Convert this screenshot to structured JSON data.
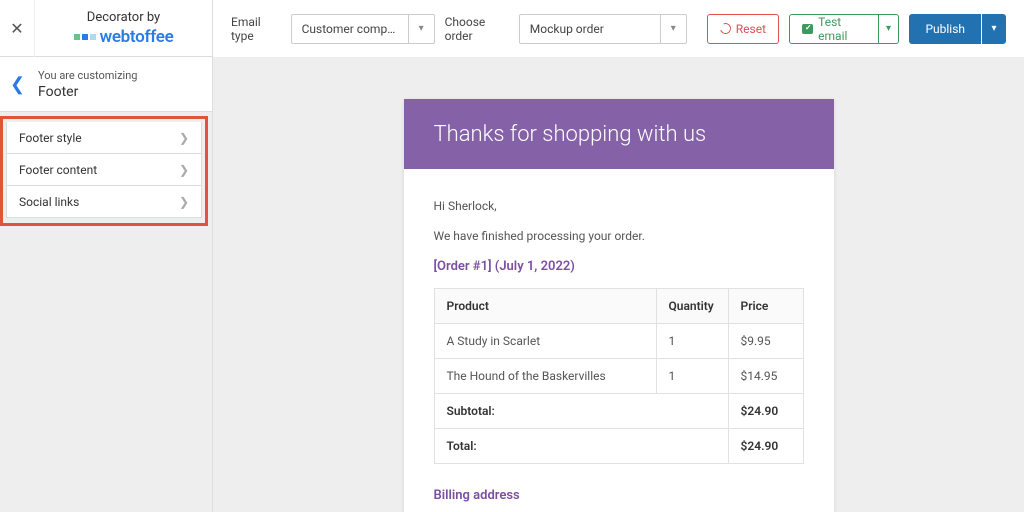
{
  "brand": {
    "top": "Decorator by",
    "name": "webtoffee"
  },
  "crumb": {
    "label": "You are customizing",
    "title": "Footer"
  },
  "options": [
    {
      "label": "Footer style"
    },
    {
      "label": "Footer content"
    },
    {
      "label": "Social links"
    }
  ],
  "topbar": {
    "emailType": {
      "label": "Email type",
      "value": "Customer completed or…"
    },
    "chooseOrder": {
      "label": "Choose order",
      "value": "Mockup order"
    },
    "reset": "Reset",
    "testEmail": "Test email",
    "publish": "Publish"
  },
  "email": {
    "title": "Thanks for shopping with us",
    "greeting": "Hi Sherlock,",
    "processing": "We have finished processing your order.",
    "orderLink": "[Order #1] (July 1, 2022)",
    "headers": {
      "product": "Product",
      "quantity": "Quantity",
      "price": "Price"
    },
    "rows": [
      {
        "product": "A Study in Scarlet",
        "qty": "1",
        "price": "$9.95"
      },
      {
        "product": "The Hound of the Baskervilles",
        "qty": "1",
        "price": "$14.95"
      }
    ],
    "summary": [
      {
        "label": "Subtotal:",
        "value": "$24.90"
      },
      {
        "label": "Total:",
        "value": "$24.90"
      }
    ],
    "billingHead": "Billing address"
  }
}
